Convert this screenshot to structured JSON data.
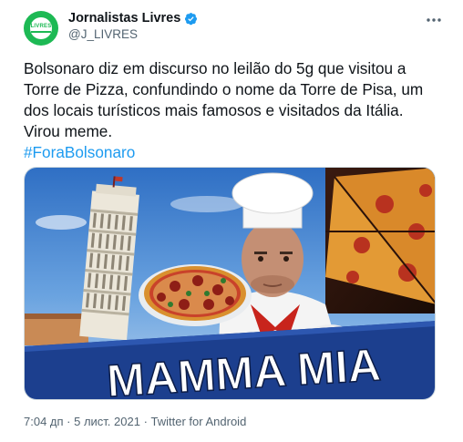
{
  "author": {
    "display_name": "Jornalistas Livres",
    "handle": "@J_LIVRES",
    "avatar_text": "LIVRES"
  },
  "tweet": {
    "text": "Bolsonaro diz em discurso no leilão do 5g que visitou a Torre de Pizza, confundindo o nome da Torre de Pisa, um dos locais  turísticos mais famosos e visitados da Itália. Virou meme.",
    "hashtag": "#ForaBolsonaro"
  },
  "media": {
    "caption": "MAMMA MIA"
  },
  "meta": {
    "time": "7:04 дп",
    "separator": " · ",
    "date": "5 лист. 2021",
    "source": "Twitter for Android"
  },
  "colors": {
    "accent": "#1d9bf0",
    "avatar_green": "#1db954",
    "banner_blue": "#1c3f8e"
  },
  "icons": [
    "verified-badge-icon",
    "more-options-icon"
  ]
}
